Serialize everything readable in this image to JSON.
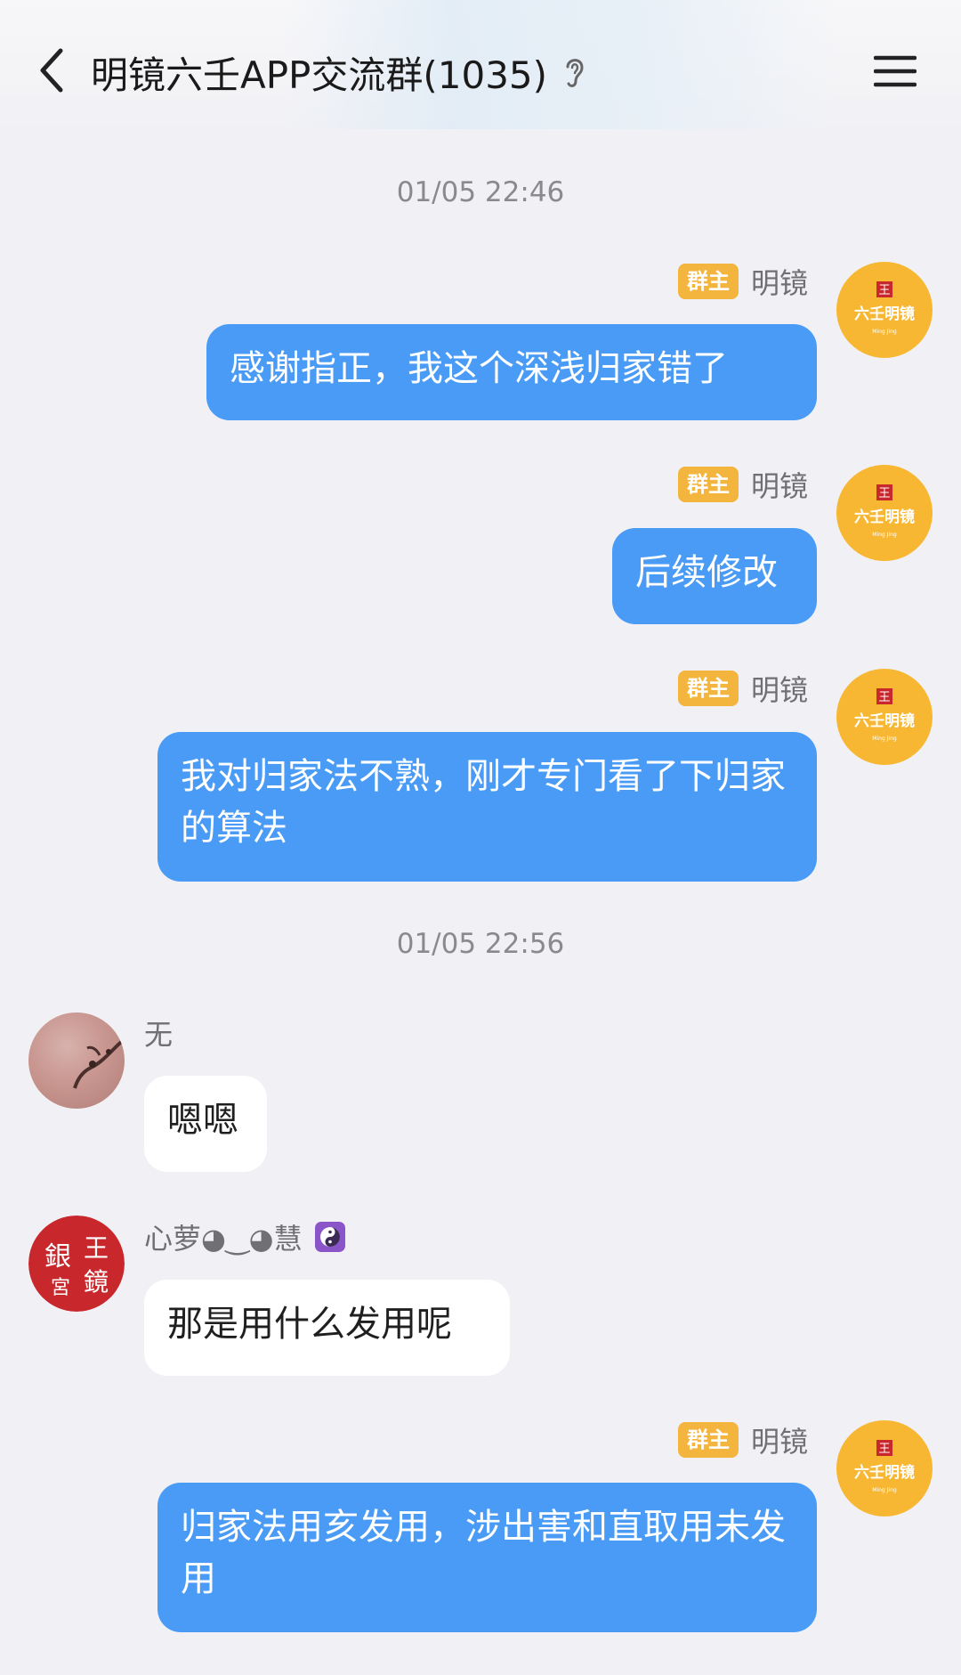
{
  "header": {
    "title": "明镜六壬APP交流群(1035)",
    "back_icon": "chevron-left-icon",
    "ear_icon": "ear-icon",
    "menu_icon": "hamburger-menu-icon"
  },
  "messages": [
    {
      "type": "timestamp",
      "text": "01/05 22:46"
    },
    {
      "type": "message",
      "side": "right",
      "badge": "群主",
      "sender": "明镜",
      "text": "感谢指正，我这个深浅归家错了"
    },
    {
      "type": "message",
      "side": "right",
      "badge": "群主",
      "sender": "明镜",
      "text": "后续修改"
    },
    {
      "type": "message",
      "side": "right",
      "badge": "群主",
      "sender": "明镜",
      "text": "我对归家法不熟，刚才专门看了下归家的算法"
    },
    {
      "type": "timestamp",
      "text": "01/05 22:56"
    },
    {
      "type": "message",
      "side": "left",
      "sender": "无",
      "text": "嗯嗯"
    },
    {
      "type": "message",
      "side": "left",
      "sender": "心萝◕‿◕慧",
      "sender_icon": "yin-yang-icon",
      "text": "那是用什么发用呢"
    },
    {
      "type": "message",
      "side": "right",
      "badge": "群主",
      "sender": "明镜",
      "text": "归家法用亥发用，涉出害和直取用未发用"
    }
  ],
  "avatars": {
    "mingjing": {
      "seal_char": "王",
      "text": "六壬明镜",
      "caption": "Ming Jing"
    },
    "xinluo": {
      "seal_chars": [
        "王",
        "鏡",
        "銀",
        "宮"
      ]
    }
  },
  "colors": {
    "background": "#f1f1f5",
    "outgoing_bubble": "#4a9bf5",
    "incoming_bubble": "#ffffff",
    "owner_badge": "#f4b53f",
    "avatar_gold": "#f7b733",
    "seal_red": "#c8282c"
  }
}
